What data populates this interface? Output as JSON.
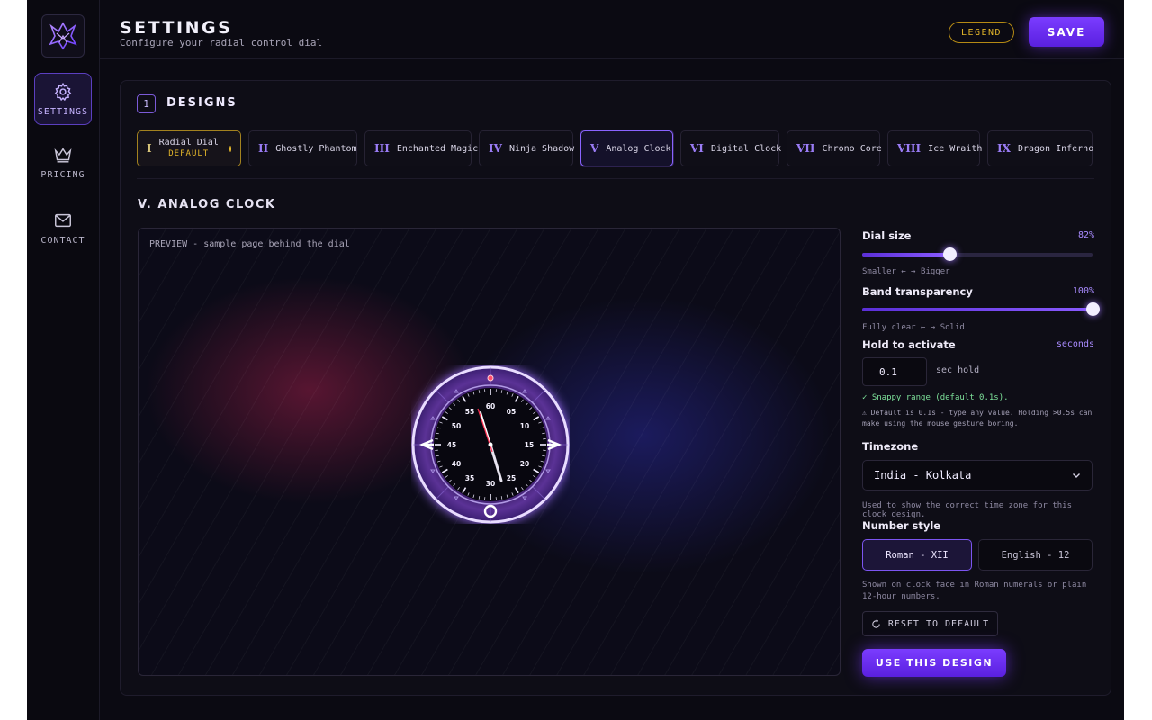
{
  "header": {
    "title": "SETTINGS",
    "subtitle": "Configure your radial control dial",
    "legend_label": "LEGEND",
    "save_label": "SAVE"
  },
  "sidebar": {
    "items": [
      {
        "label": "SETTINGS",
        "icon": "gear-icon",
        "active": true
      },
      {
        "label": "PRICING",
        "icon": "crown-icon",
        "active": false
      },
      {
        "label": "CONTACT",
        "icon": "mail-icon",
        "active": false
      }
    ]
  },
  "designs": {
    "section_number": "1",
    "section_title": "DESIGNS",
    "default_tag": "DEFAULT",
    "items": [
      {
        "num": "I",
        "label": "Radial Dial"
      },
      {
        "num": "II",
        "label": "Ghostly Phantom"
      },
      {
        "num": "III",
        "label": "Enchanted Magic"
      },
      {
        "num": "IV",
        "label": "Ninja Shadow"
      },
      {
        "num": "V",
        "label": "Analog Clock"
      },
      {
        "num": "VI",
        "label": "Digital Clock"
      },
      {
        "num": "VII",
        "label": "Chrono Core"
      },
      {
        "num": "VIII",
        "label": "Ice Wraith"
      },
      {
        "num": "IX",
        "label": "Dragon Inferno"
      }
    ],
    "selected_index": 4,
    "default_index": 0
  },
  "current": {
    "title": "V. ANALOG CLOCK",
    "preview_label": "PREVIEW - sample page behind the dial",
    "dial_numbers": [
      "60",
      "05",
      "10",
      "15",
      "20",
      "25",
      "30",
      "35",
      "40",
      "45",
      "50",
      "55"
    ]
  },
  "controls": {
    "dial_size": {
      "label": "Dial size",
      "value_text": "82%",
      "value": 0.38,
      "hint": "Smaller ← → Bigger"
    },
    "band_transparency": {
      "label": "Band transparency",
      "value_text": "100%",
      "value": 1.0,
      "hint": "Fully clear ← → Solid"
    },
    "hold": {
      "label": "Hold to activate",
      "unit": "seconds",
      "value": "0.1",
      "suffix": "sec hold",
      "ok": "✓ Snappy range (default 0.1s).",
      "warn": "⚠ Default is 0.1s - type any value. Holding >0.5s can make using the mouse gesture boring."
    },
    "timezone": {
      "label": "Timezone",
      "value": "India - Kolkata",
      "hint": "Used to show the correct time zone for this clock design."
    },
    "number_style": {
      "label": "Number style",
      "options": [
        "Roman - XII",
        "English - 12"
      ],
      "selected": 0,
      "hint": "Shown on clock face in Roman numerals or plain 12-hour numbers."
    },
    "reset_label": "RESET TO DEFAULT",
    "use_label": "USE THIS DESIGN"
  },
  "colors": {
    "accent": "#7b3cff",
    "gold": "#e3b62a",
    "ok": "#7ee39b"
  }
}
